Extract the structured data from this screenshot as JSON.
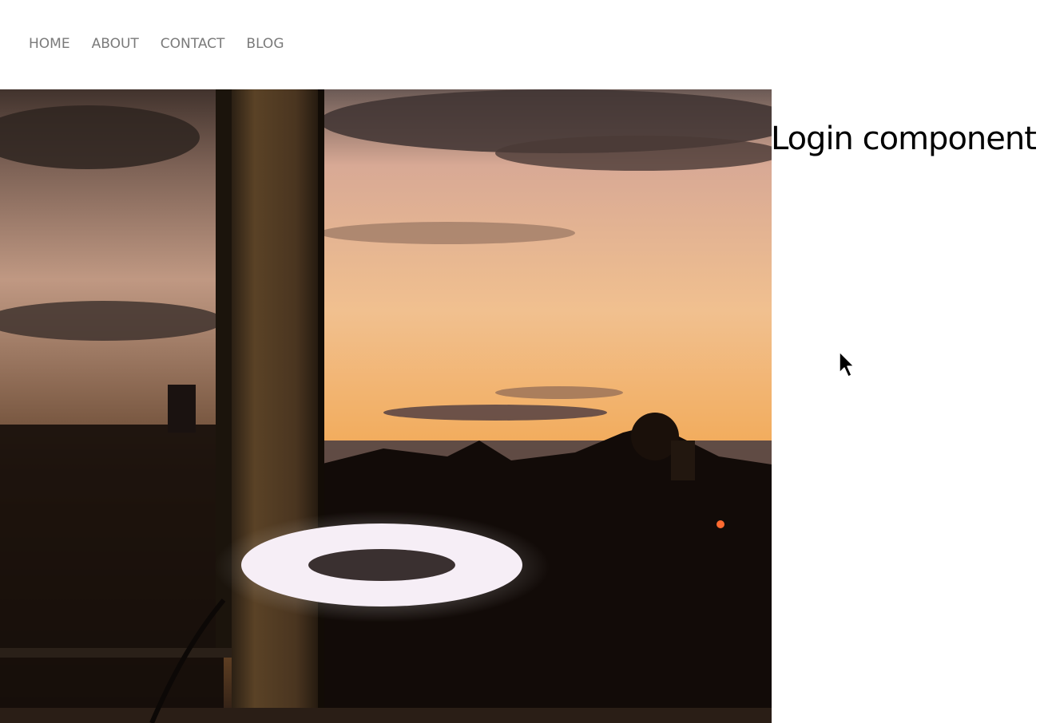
{
  "nav": {
    "items": [
      {
        "label": "HOME"
      },
      {
        "label": "ABOUT"
      },
      {
        "label": "CONTACT"
      },
      {
        "label": "BLOG"
      }
    ]
  },
  "main": {
    "title": "Login component g"
  },
  "colors": {
    "nav_text": "#7a7a7a",
    "title_text": "#000000",
    "background": "#ffffff"
  },
  "icons": {
    "pointer": "mouse-cursor-icon"
  }
}
